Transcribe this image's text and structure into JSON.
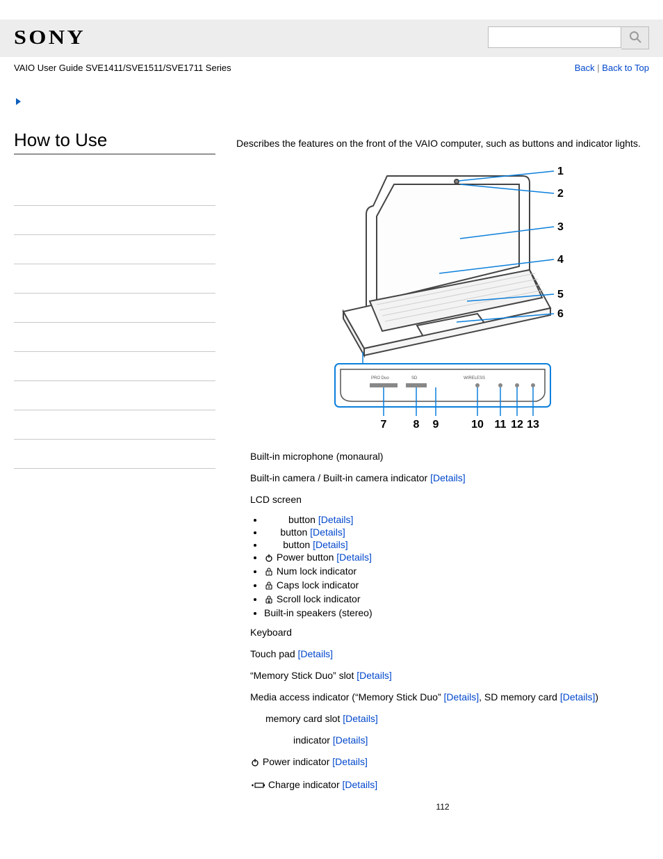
{
  "brand": "SONY",
  "guide_title": "VAIO User Guide SVE1411/SVE1511/SVE1711 Series",
  "nav": {
    "back": "Back",
    "sep": " | ",
    "top": "Back to Top"
  },
  "search": {
    "value": "",
    "placeholder": ""
  },
  "section_title": "How to Use",
  "intro": "Describes the features on the front of the VAIO computer, such as buttons and indicator lights.",
  "details": "[Details]",
  "diagram": {
    "right_labels": [
      "1",
      "2",
      "3",
      "4",
      "5",
      "6"
    ],
    "bottom_labels": [
      "7",
      "8",
      "9",
      "10",
      "11",
      "12",
      "13"
    ],
    "front_panel": [
      "PRO Duo",
      "SD",
      "WIRELESS"
    ]
  },
  "items": {
    "mic": "Built-in microphone (monaural)",
    "camera": "Built-in camera / Built-in camera indicator ",
    "lcd": "LCD screen",
    "btn1": "button ",
    "btn2": "button ",
    "btn3": "button ",
    "power_btn": "Power button ",
    "numlk": "Num lock indicator",
    "caps": "Caps lock indicator",
    "scroll": "Scroll lock indicator",
    "speakers": "Built-in speakers (stereo)",
    "keyboard": "Keyboard",
    "touchpad": "Touch pad ",
    "msslot": "“Memory Stick Duo” slot ",
    "media1": "Media access indicator (“Memory Stick Duo” ",
    "media2": ", SD memory card ",
    "media3": ")",
    "sdslot": " memory card slot ",
    "ind": " indicator ",
    "pwrind": "Power indicator ",
    "chgind": "Charge indicator "
  },
  "page_number": "112"
}
